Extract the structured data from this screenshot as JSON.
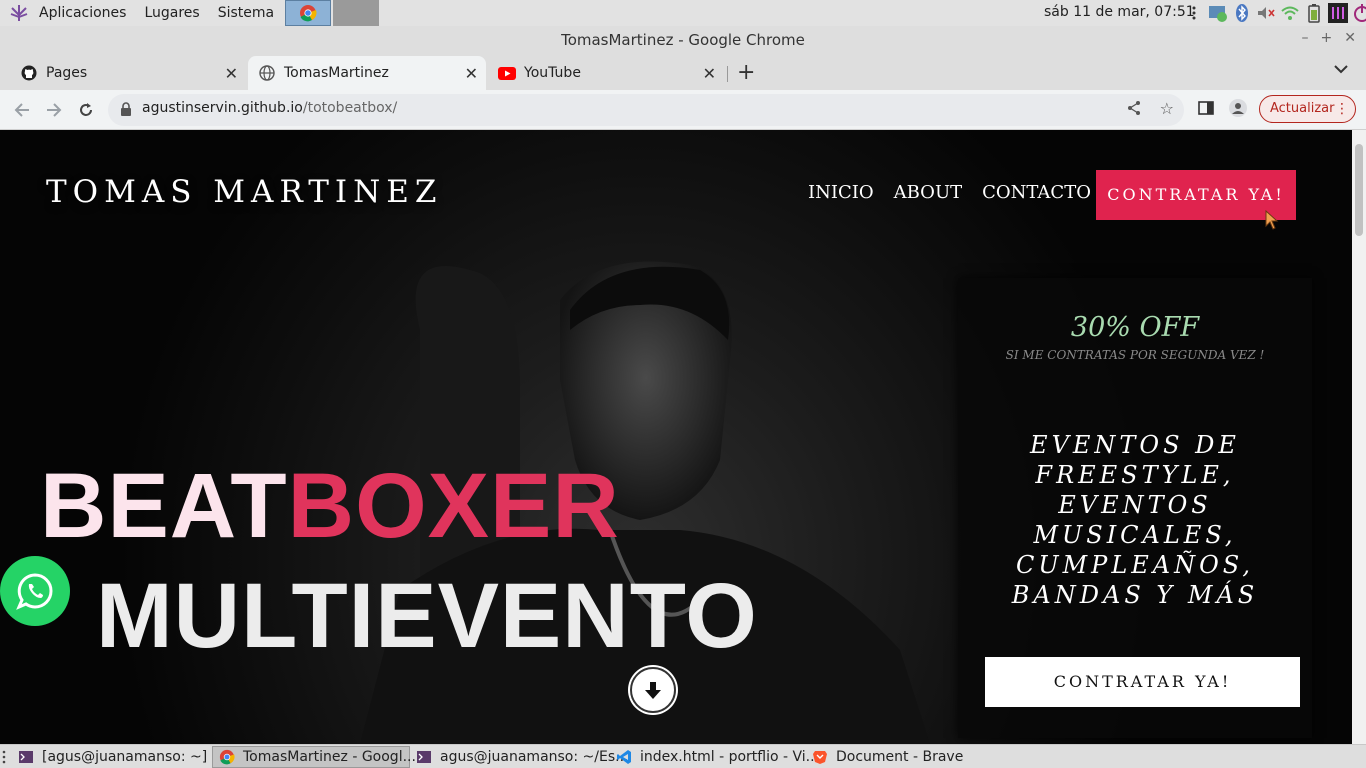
{
  "top_panel": {
    "menus": [
      "Aplicaciones",
      "Lugares",
      "Sistema"
    ],
    "clock": "sáb 11 de mar, 07:51"
  },
  "window": {
    "title": "TomasMartinez - Google Chrome"
  },
  "tabs": [
    {
      "label": "Pages",
      "icon": "github-icon"
    },
    {
      "label": "TomasMartinez",
      "icon": "globe-icon"
    },
    {
      "label": "YouTube",
      "icon": "youtube-icon"
    }
  ],
  "address_bar": {
    "host": "agustinservin.github.io",
    "path": "/totobeatbox/"
  },
  "update_button": "Actualizar",
  "site": {
    "title": "TOMAS MARTINEZ",
    "nav": [
      "INICIO",
      "ABOUT",
      "CONTACTO"
    ],
    "nav_cta": "CONTRATAR YA!",
    "headline_part1": "BEAT",
    "headline_part2": "BOXER",
    "headline_line2": "MULTIEVENTO",
    "promo": {
      "discount": "30% OFF",
      "subtitle": "SI ME CONTRATAS POR SEGUNDA VEZ !",
      "events": "EVENTOS DE FREESTYLE, EVENTOS MUSICALES, CUMPLEAÑOS, BANDAS Y MÁS",
      "cta": "CONTRATAR YA!"
    }
  },
  "taskbar": [
    {
      "label": "[agus@juanamanso: ~]",
      "icon": "terminal-icon",
      "active": false
    },
    {
      "label": "TomasMartinez - Googl...",
      "icon": "chrome-icon",
      "active": true
    },
    {
      "label": "agus@juanamanso: ~/Es...",
      "icon": "terminal-icon",
      "active": false
    },
    {
      "label": "index.html - portflio - Vi...",
      "icon": "vscode-icon",
      "active": false
    },
    {
      "label": "Document - Brave",
      "icon": "brave-icon",
      "active": false
    }
  ],
  "colors": {
    "accent_red": "#e0234e",
    "boxer_red": "#e0345c",
    "promo_green": "#a9dbb0",
    "whatsapp_green": "#25d366"
  }
}
